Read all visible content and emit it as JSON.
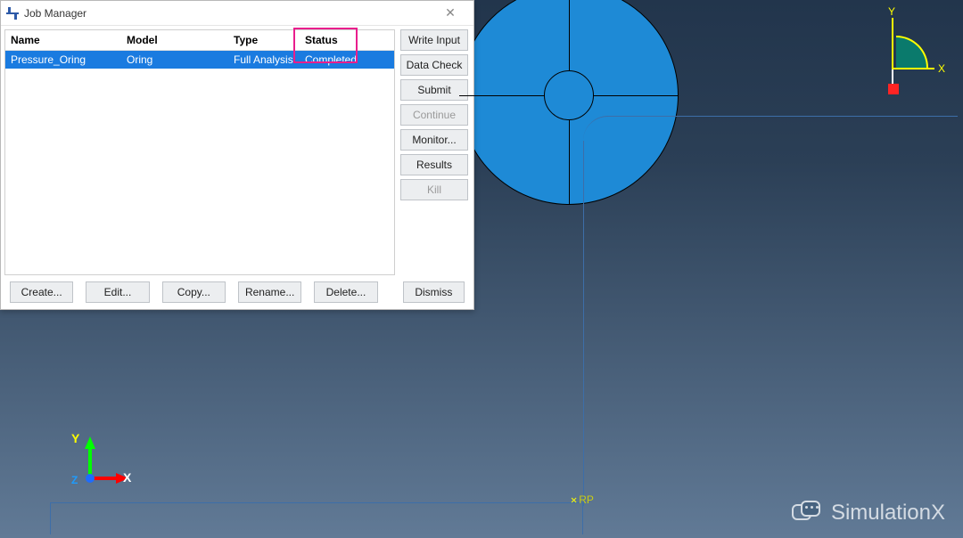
{
  "dialog": {
    "title": "Job Manager",
    "columns": {
      "name": "Name",
      "model": "Model",
      "type": "Type",
      "status": "Status"
    },
    "rows": [
      {
        "name": "Pressure_Oring",
        "model": "Oring",
        "type": "Full Analysis",
        "status": "Completed"
      }
    ],
    "side_buttons": {
      "write_input": "Write Input",
      "data_check": "Data Check",
      "submit": "Submit",
      "continue": "Continue",
      "monitor": "Monitor...",
      "results": "Results",
      "kill": "Kill"
    },
    "bottom_buttons": {
      "create": "Create...",
      "edit": "Edit...",
      "copy": "Copy...",
      "rename": "Rename...",
      "delete": "Delete...",
      "dismiss": "Dismiss"
    }
  },
  "viewport": {
    "rp_label": "RP",
    "triad": {
      "x": "X",
      "y": "Y",
      "z": "Z"
    },
    "viewcube": {
      "x": "X",
      "y": "Y"
    }
  },
  "watermark": {
    "text": "SimulationX"
  }
}
